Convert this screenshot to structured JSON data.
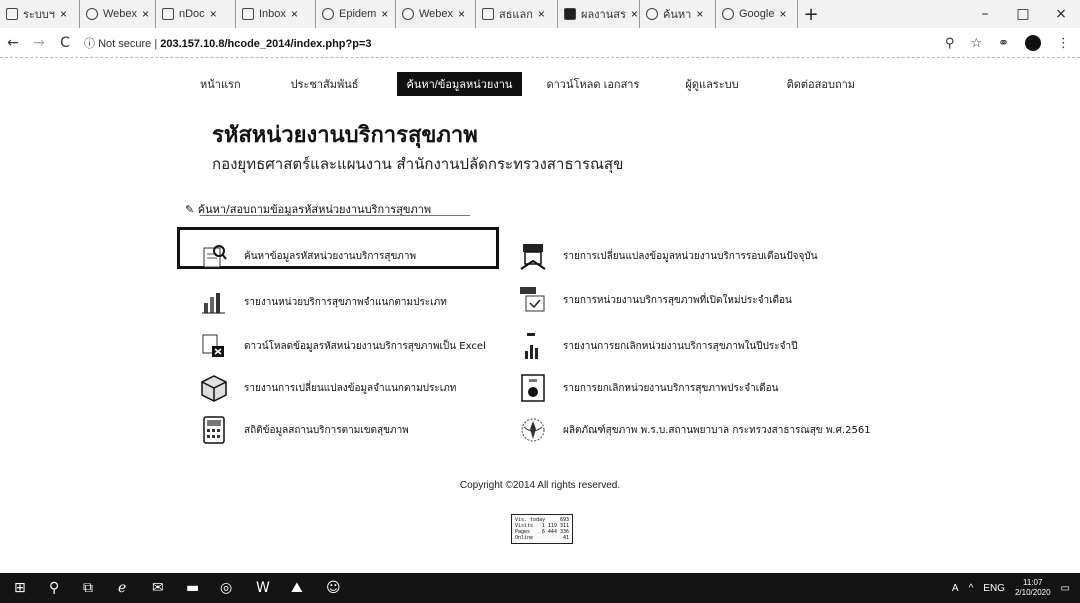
{
  "browser": {
    "tabs": [
      {
        "title": "ระบบฯ",
        "favicon": "page-icon"
      },
      {
        "title": "Webex",
        "favicon": "webex-icon"
      },
      {
        "title": "nDoc",
        "favicon": "page-icon"
      },
      {
        "title": "Inbox",
        "favicon": "gmail-icon"
      },
      {
        "title": "Epidem",
        "favicon": "google-icon"
      },
      {
        "title": "Webex",
        "favicon": "webex-icon"
      },
      {
        "title": "สธแลก",
        "favicon": "page-icon"
      },
      {
        "title": "ผลงานสร",
        "favicon": "sheet-icon"
      },
      {
        "title": "ค้นหา",
        "favicon": "google-icon"
      },
      {
        "title": "Google",
        "favicon": "google-icon"
      }
    ],
    "new_tab_label": "+",
    "window_controls": {
      "minimize": "–",
      "maximize": "□",
      "close": "×"
    },
    "nav": {
      "back": "←",
      "forward": "→",
      "reload": "C"
    },
    "security_label": "Not secure",
    "url": "203.157.10.8/hcode_2014/index.php?p=3",
    "zoom_icon": "zoom-icon",
    "star_icon": "bookmark-star-icon"
  },
  "site": {
    "menu": [
      {
        "label": "หน้าแรก"
      },
      {
        "label": "ประชาสัมพันธ์"
      },
      {
        "label": "ค้นหา/ข้อมูลหน่วยงาน"
      },
      {
        "label": "ดาวน์โหลด เอกสาร"
      },
      {
        "label": "ผู้ดูแลระบบ"
      },
      {
        "label": "ติดต่อสอบถาม"
      }
    ],
    "active_menu_index": 2,
    "title": "รหัสหน่วยงานบริการสุขภาพ",
    "subtitle": "กองยุทธศาสตร์และแผนงาน สำนักงานปลัดกระทรวงสาธารณสุข",
    "section_heading": "ค้นหา/สอบถามข้อมูลรหัสหน่วยงานบริการสุขภาพ",
    "left_items": [
      {
        "label": "ค้นหาข้อมูลรหัสหน่วยงานบริการสุขภาพ",
        "icon": "magnifier-document-icon"
      },
      {
        "label": "รายงานหน่วยบริการสุขภาพจำแนกตามประเภท",
        "icon": "bar-chart-icon"
      },
      {
        "label": "ดาวน์โหลดข้อมูลรหัสหน่วยงานบริการสุขภาพเป็น Excel",
        "icon": "excel-download-icon"
      },
      {
        "label": "รายงานการเปลี่ยนแปลงข้อมูลจำแนกตามประเภท",
        "icon": "box-cube-icon"
      },
      {
        "label": "สถิติข้อมูลสถานบริการตามเขตสุขภาพ",
        "icon": "calculator-icon"
      }
    ],
    "right_items": [
      {
        "label": "รายการเปลี่ยนแปลงข้อมูลหน่วยงานบริการรอบเดือนปัจจุบัน",
        "icon": "hospital-building-icon"
      },
      {
        "label": "รายการหน่วยงานบริการสุขภาพที่เปิดใหม่ประจำเดือน",
        "icon": "new-clinic-icon"
      },
      {
        "label": "รายงานการยกเลิกหน่วยงานบริการสุขภาพในปีประจำปี",
        "icon": "report-chart-icon"
      },
      {
        "label": "รายการยกเลิกหน่วยงานบริการสุขภาพประจำเดือน",
        "icon": "cancel-document-icon"
      },
      {
        "label": "ผลิตภัณฑ์สุขภาพ พ.ร.บ.สถานพยาบาล กระทรวงสาธารณสุข พ.ศ.2561",
        "icon": "ministry-seal-icon"
      }
    ],
    "copyright": "Copyright ©2014 All rights reserved.",
    "counter": [
      {
        "label": "Vis. today",
        "value": "693"
      },
      {
        "label": "Visits",
        "value": "1 119 311"
      },
      {
        "label": "Pages",
        "value": "6 444 336"
      },
      {
        "label": "Online",
        "value": "41"
      }
    ]
  },
  "taskbar": {
    "icons": [
      "windows-start-icon",
      "search-icon",
      "task-view-icon",
      "edge-icon",
      "mail-icon",
      "file-explorer-icon",
      "chrome-icon",
      "word-icon",
      "photos-icon",
      "line-icon"
    ],
    "tray": {
      "font_indicator": "A",
      "chevron": "^",
      "language": "ENG",
      "time": "11:07",
      "date": "2/10/2020"
    }
  }
}
